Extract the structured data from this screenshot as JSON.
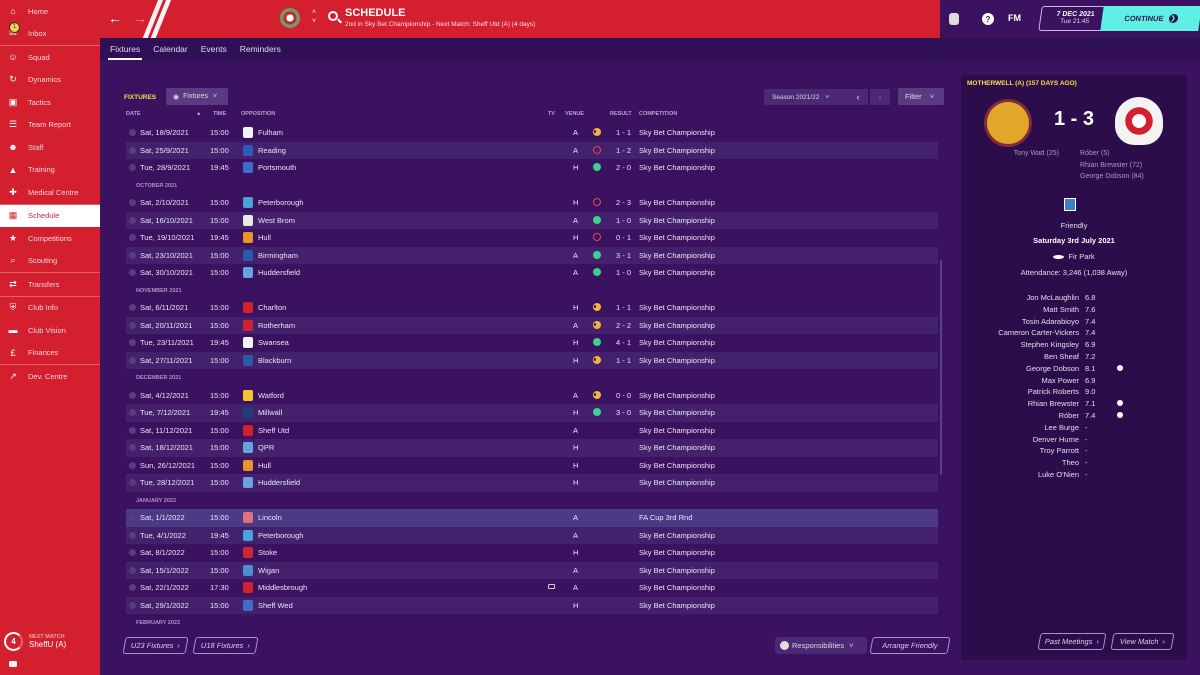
{
  "sidebar": {
    "items": [
      {
        "label": "Home",
        "icon": "home-icon"
      },
      {
        "label": "Inbox",
        "icon": "inbox-icon",
        "badge": "1"
      },
      {
        "label": "Squad",
        "icon": "squad-icon"
      },
      {
        "label": "Dynamics",
        "icon": "dynamics-icon"
      },
      {
        "label": "Tactics",
        "icon": "tactics-icon"
      },
      {
        "label": "Team Report",
        "icon": "team-report-icon"
      },
      {
        "label": "Staff",
        "icon": "staff-icon"
      },
      {
        "label": "Training",
        "icon": "training-icon"
      },
      {
        "label": "Medical Centre",
        "icon": "medical-icon"
      },
      {
        "label": "Schedule",
        "icon": "calendar-icon",
        "active": true
      },
      {
        "label": "Competitions",
        "icon": "trophy-icon"
      },
      {
        "label": "Scouting",
        "icon": "scouting-icon"
      },
      {
        "label": "Transfers",
        "icon": "transfers-icon"
      },
      {
        "label": "Club Info",
        "icon": "shield-icon"
      },
      {
        "label": "Club Vision",
        "icon": "briefcase-icon"
      },
      {
        "label": "Finances",
        "icon": "money-icon"
      },
      {
        "label": "Dev. Centre",
        "icon": "growth-icon"
      }
    ],
    "next_match": {
      "label": "NEXT MATCH",
      "days": "4",
      "value": "SheffU (A)"
    }
  },
  "header": {
    "title": "SCHEDULE",
    "subtitle": "2nd in Sky Bet Championship - Next Match: Sheff Utd (A) (4 days)",
    "fm_label": "FM",
    "help": "?",
    "date": "7 DEC 2021",
    "time": "Tue 21:45",
    "continue_label": "CONTINUE"
  },
  "tabs": [
    "Fixtures",
    "Calendar",
    "Events",
    "Reminders"
  ],
  "fixtures": {
    "label": "FIXTURES",
    "view_label": "Fixtures",
    "season": "Season 2021/22",
    "filter": "Filter",
    "columns": {
      "date": "DATE",
      "time": "TIME",
      "opposition": "OPPOSITION",
      "tv": "TV",
      "venue": "VENUE",
      "result": "RESULT",
      "competition": "COMPETITION"
    },
    "rows": [
      {
        "date": "Sat, 18/9/2021",
        "time": "15:00",
        "opp": "Fulham",
        "venue": "A",
        "outcome": "draw",
        "result": "1 - 1",
        "comp": "Sky Bet Championship",
        "crest": "#f2f2f2"
      },
      {
        "date": "Sat, 25/9/2021",
        "time": "15:00",
        "opp": "Reading",
        "venue": "A",
        "outcome": "loss",
        "result": "1 - 2",
        "comp": "Sky Bet Championship",
        "crest": "#2b5bb5"
      },
      {
        "date": "Tue, 28/9/2021",
        "time": "19:45",
        "opp": "Portsmouth",
        "venue": "H",
        "outcome": "win",
        "result": "2 - 0",
        "comp": "Sky Bet Championship",
        "crest": "#3d6cc9"
      },
      {
        "month": "OCTOBER 2021"
      },
      {
        "date": "Sat, 2/10/2021",
        "time": "15:00",
        "opp": "Peterborough",
        "venue": "H",
        "outcome": "loss",
        "result": "2 - 3",
        "comp": "Sky Bet Championship",
        "crest": "#4aa3d8"
      },
      {
        "date": "Sat, 16/10/2021",
        "time": "15:00",
        "opp": "West Brom",
        "venue": "A",
        "outcome": "win",
        "result": "1 - 0",
        "comp": "Sky Bet Championship",
        "crest": "#e8e8e8"
      },
      {
        "date": "Tue, 19/10/2021",
        "time": "19:45",
        "opp": "Hull",
        "venue": "H",
        "outcome": "loss",
        "result": "0 - 1",
        "comp": "Sky Bet Championship",
        "crest": "#e5962a"
      },
      {
        "date": "Sat, 23/10/2021",
        "time": "15:00",
        "opp": "Birmingham",
        "venue": "A",
        "outcome": "win",
        "result": "3 - 1",
        "comp": "Sky Bet Championship",
        "crest": "#2b58b0"
      },
      {
        "date": "Sat, 30/10/2021",
        "time": "15:00",
        "opp": "Huddersfield",
        "venue": "A",
        "outcome": "win",
        "result": "1 - 0",
        "comp": "Sky Bet Championship",
        "crest": "#6aa2e0"
      },
      {
        "month": "NOVEMBER 2021"
      },
      {
        "date": "Sat, 6/11/2021",
        "time": "15:00",
        "opp": "Charlton",
        "venue": "H",
        "outcome": "draw",
        "result": "1 - 1",
        "comp": "Sky Bet Championship",
        "crest": "#d1232f"
      },
      {
        "date": "Sat, 20/11/2021",
        "time": "15:00",
        "opp": "Rotherham",
        "venue": "A",
        "outcome": "draw",
        "result": "2 - 2",
        "comp": "Sky Bet Championship",
        "crest": "#d1232f"
      },
      {
        "date": "Tue, 23/11/2021",
        "time": "19:45",
        "opp": "Swansea",
        "venue": "H",
        "outcome": "win",
        "result": "4 - 1",
        "comp": "Sky Bet Championship",
        "crest": "#f2f2f2"
      },
      {
        "date": "Sat, 27/11/2021",
        "time": "15:00",
        "opp": "Blackburn",
        "venue": "H",
        "outcome": "draw",
        "result": "1 - 1",
        "comp": "Sky Bet Championship",
        "crest": "#2a5aa8"
      },
      {
        "month": "DECEMBER 2021"
      },
      {
        "date": "Sat, 4/12/2021",
        "time": "15:00",
        "opp": "Watford",
        "venue": "A",
        "outcome": "draw",
        "result": "0 - 0",
        "comp": "Sky Bet Championship",
        "crest": "#f2c530"
      },
      {
        "date": "Tue, 7/12/2021",
        "time": "19:45",
        "opp": "Millwall",
        "venue": "H",
        "outcome": "win",
        "result": "3 - 0",
        "comp": "Sky Bet Championship",
        "crest": "#1d3f7a"
      },
      {
        "date": "Sat, 11/12/2021",
        "time": "15:00",
        "opp": "Sheff Utd",
        "venue": "A",
        "outcome": "",
        "result": "",
        "comp": "Sky Bet Championship",
        "crest": "#d1232f"
      },
      {
        "date": "Sat, 18/12/2021",
        "time": "15:00",
        "opp": "QPR",
        "venue": "H",
        "outcome": "",
        "result": "",
        "comp": "Sky Bet Championship",
        "crest": "#6aa2e0"
      },
      {
        "date": "Sun, 26/12/2021",
        "time": "15:00",
        "opp": "Hull",
        "venue": "H",
        "outcome": "",
        "result": "",
        "comp": "Sky Bet Championship",
        "crest": "#e5962a"
      },
      {
        "date": "Tue, 28/12/2021",
        "time": "15:00",
        "opp": "Huddersfield",
        "venue": "H",
        "outcome": "",
        "result": "",
        "comp": "Sky Bet Championship",
        "crest": "#6aa2e0"
      },
      {
        "month": "JANUARY 2022"
      },
      {
        "date": "Sat, 1/1/2022",
        "time": "15:00",
        "opp": "Lincoln",
        "venue": "A",
        "outcome": "",
        "result": "",
        "comp": "FA Cup 3rd Rnd",
        "crest": "#e0707a",
        "selected": true
      },
      {
        "date": "Tue, 4/1/2022",
        "time": "19:45",
        "opp": "Peterborough",
        "venue": "A",
        "outcome": "",
        "result": "",
        "comp": "Sky Bet Championship",
        "crest": "#4aa3d8"
      },
      {
        "date": "Sat, 8/1/2022",
        "time": "15:00",
        "opp": "Stoke",
        "venue": "H",
        "outcome": "",
        "result": "",
        "comp": "Sky Bet Championship",
        "crest": "#d1232f"
      },
      {
        "date": "Sat, 15/1/2022",
        "time": "15:00",
        "opp": "Wigan",
        "venue": "A",
        "outcome": "",
        "result": "",
        "comp": "Sky Bet Championship",
        "crest": "#4a8ed0"
      },
      {
        "date": "Sat, 22/1/2022",
        "time": "17:30",
        "opp": "Middlesbrough",
        "venue": "A",
        "outcome": "",
        "result": "",
        "comp": "Sky Bet Championship",
        "crest": "#d1232f",
        "tv": true
      },
      {
        "date": "Sat, 29/1/2022",
        "time": "15:00",
        "opp": "Sheff Wed",
        "venue": "H",
        "outcome": "",
        "result": "",
        "comp": "Sky Bet Championship",
        "crest": "#3d6cc9"
      },
      {
        "month": "FEBRUARY 2022"
      }
    ]
  },
  "bottom": {
    "u23": "U23 Fixtures",
    "u18": "U18 Fixtures",
    "responsibilities": "Responsibilities",
    "arrange_friendly": "Arrange Friendly",
    "past_meetings": "Past Meetings",
    "view_match": "View Match"
  },
  "match_panel": {
    "title": "MOTHERWELL (A) (157 DAYS AGO)",
    "score": "1 - 3",
    "home_scorers": [
      "Tony Watt (25)"
    ],
    "away_scorers": [
      "Róber (5)",
      "Rhian Brewster (72)",
      "George Dobson (84)"
    ],
    "competition": "Friendly",
    "date": "Saturday 3rd July 2021",
    "stadium": "Fir Park",
    "attendance": "Attendance: 3,246 (1,038 Away)",
    "lineup": [
      {
        "name": "Jon McLaughlin",
        "rating": "6.8"
      },
      {
        "name": "Matt Smith",
        "rating": "7.6"
      },
      {
        "name": "Tosin Adarabioyo",
        "rating": "7.4"
      },
      {
        "name": "Cameron Carter-Vickers",
        "rating": "7.4"
      },
      {
        "name": "Stephen Kingsley",
        "rating": "6.9"
      },
      {
        "name": "Ben Sheaf",
        "rating": "7.2"
      },
      {
        "name": "George Dobson",
        "rating": "8.1",
        "goal": true
      },
      {
        "name": "Max Power",
        "rating": "6.9"
      },
      {
        "name": "Patrick Roberts",
        "rating": "9.0"
      },
      {
        "name": "Rhian Brewster",
        "rating": "7.1",
        "goal": true
      },
      {
        "name": "Róber",
        "rating": "7.4",
        "goal": true
      },
      {
        "name": "Lee Burge",
        "rating": "-"
      },
      {
        "name": "Denver Hume",
        "rating": "-"
      },
      {
        "name": "Troy Parrott",
        "rating": "-"
      },
      {
        "name": "Theo",
        "rating": "-"
      },
      {
        "name": "Luke O'Nien",
        "rating": "-"
      }
    ]
  },
  "colors": {
    "primary": "#d41f2f",
    "background": "#3a1260",
    "accent": "#5ff0e3",
    "win": "#3ecf8e",
    "draw": "#f1b33f",
    "loss": "#e04a55",
    "highlight": "#f5e042"
  }
}
